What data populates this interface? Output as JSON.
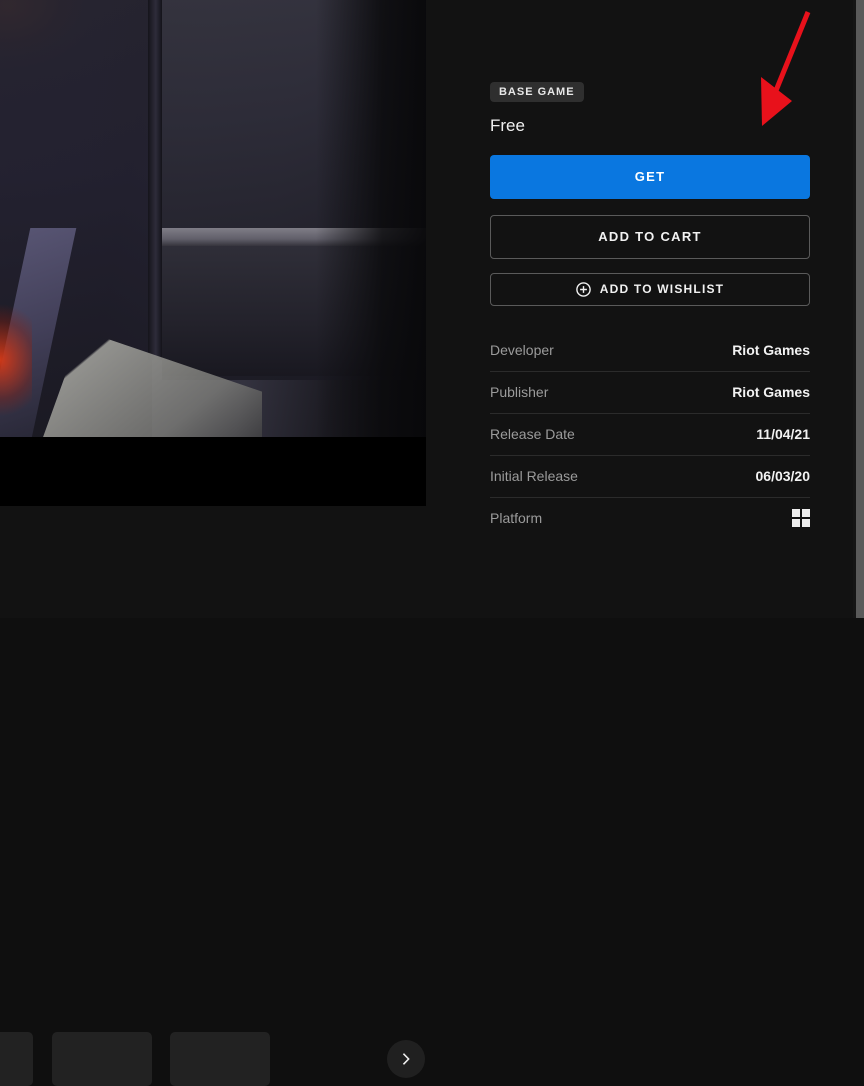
{
  "store_page": {
    "media": {
      "carousel_next_icon": "chevron-right-icon",
      "thumbnail_count": 3
    },
    "purchase": {
      "badge_label": "BASE GAME",
      "price_label": "Free",
      "get_label": "GET",
      "add_to_cart_label": "ADD TO CART",
      "wishlist_label": "ADD TO WISHLIST",
      "wishlist_icon": "plus-circle-icon",
      "accent_color": "#0a77e0"
    },
    "details": {
      "rows": [
        {
          "key": "Developer",
          "value": "Riot Games",
          "type": "text"
        },
        {
          "key": "Publisher",
          "value": "Riot Games",
          "type": "text"
        },
        {
          "key": "Release Date",
          "value": "11/04/21",
          "type": "text"
        },
        {
          "key": "Initial Release",
          "value": "06/03/20",
          "type": "text"
        },
        {
          "key": "Platform",
          "value": "",
          "type": "icon",
          "icon": "windows-logo-icon"
        }
      ]
    },
    "annotation": {
      "type": "arrow",
      "color": "#e8111b",
      "points_to": "get-button"
    }
  }
}
